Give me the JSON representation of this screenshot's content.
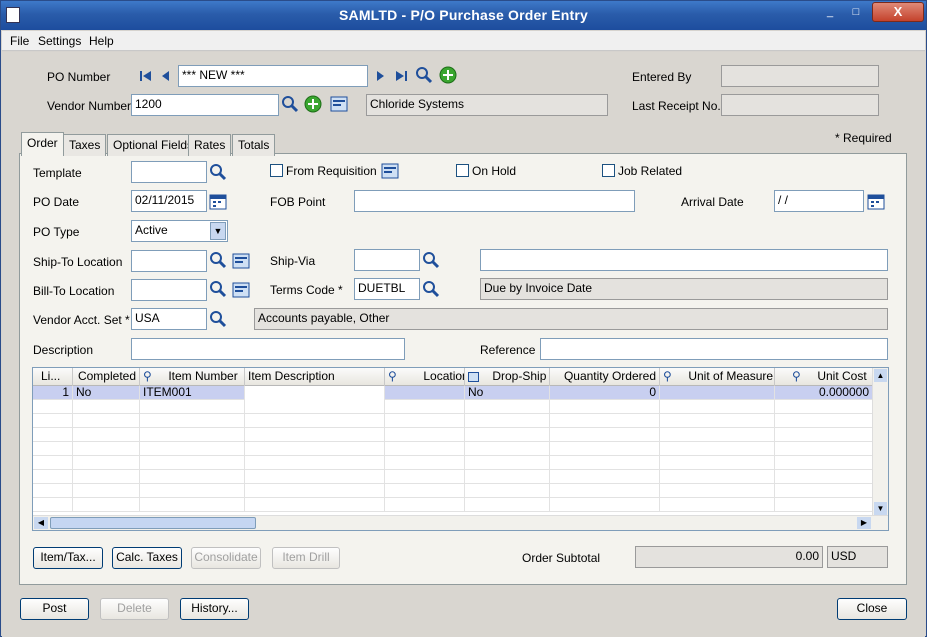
{
  "window": {
    "title": "SAMLTD - P/O Purchase Order Entry",
    "min_glyph": "_",
    "max_glyph": "□",
    "close_glyph": "X"
  },
  "menu": [
    "File",
    "Settings",
    "Help"
  ],
  "header": {
    "po_number_label": "PO Number",
    "po_number_value": "*** NEW ***",
    "vendor_number_label": "Vendor Number *",
    "vendor_number_value": "1200",
    "vendor_name": "Chloride Systems",
    "entered_by_label": "Entered By",
    "entered_by_value": "",
    "last_receipt_label": "Last Receipt No.",
    "last_receipt_value": ""
  },
  "required_note": "*  Required",
  "tabs": [
    "Order",
    "Taxes",
    "Optional Fields",
    "Rates",
    "Totals"
  ],
  "order": {
    "template_label": "Template",
    "template_value": "",
    "from_requisition_label": "From Requisition",
    "on_hold_label": "On Hold",
    "job_related_label": "Job Related",
    "po_date_label": "PO Date",
    "po_date_value": "02/11/2015",
    "fob_label": "FOB Point",
    "fob_value": "",
    "arrival_label": "Arrival Date",
    "arrival_value": " / /",
    "po_type_label": "PO Type",
    "po_type_value": "Active",
    "shipto_label": "Ship-To Location",
    "shipto_value": "",
    "shipvia_label": "Ship-Via",
    "shipvia_value": "",
    "shipvia_desc": "",
    "billto_label": "Bill-To Location",
    "billto_value": "",
    "terms_label": "Terms Code *",
    "terms_value": "DUETBL",
    "terms_desc": "Due by Invoice Date",
    "vendor_acct_label": "Vendor Acct. Set *",
    "vendor_acct_value": "USA",
    "vendor_acct_desc": "Accounts payable, Other",
    "description_label": "Description",
    "description_value": "",
    "reference_label": "Reference",
    "reference_value": ""
  },
  "grid": {
    "columns": [
      "Li...",
      "Completed",
      "Item Number",
      "Item Description",
      "Location",
      "Drop-Ship",
      "Quantity Ordered",
      "Unit of Measure",
      "Unit Cost"
    ],
    "rows": [
      {
        "line": "1",
        "completed": "No",
        "item": "ITEM001",
        "desc": "",
        "location": "",
        "dropship": "No",
        "qty": "0",
        "uom": "",
        "cost": "0.000000"
      }
    ]
  },
  "actions": {
    "item_tax": "Item/Tax...",
    "calc_taxes": "Calc. Taxes",
    "consolidate": "Consolidate",
    "item_drill": "Item Drill"
  },
  "subtotal": {
    "label": "Order Subtotal",
    "value": "0.00",
    "currency": "USD"
  },
  "footer": {
    "post": "Post",
    "delete": "Delete",
    "history": "History...",
    "close": "Close"
  }
}
